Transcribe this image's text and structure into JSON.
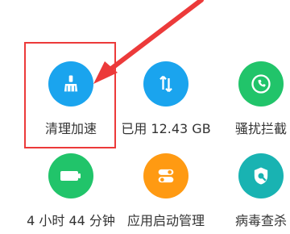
{
  "tiles": [
    {
      "label": "清理加速",
      "icon": "broom-icon",
      "color": "#1aa4ee"
    },
    {
      "label": "已用 12.43 GB",
      "icon": "swap-arrows-icon",
      "color": "#1aa4ee"
    },
    {
      "label": "骚扰拦截",
      "icon": "phone-block-icon",
      "color": "#21c46a"
    },
    {
      "label": "4 小时 44 分钟",
      "icon": "battery-icon",
      "color": "#21c46a"
    },
    {
      "label": "应用启动管理",
      "icon": "toggle-icon",
      "color": "#ff9a12"
    },
    {
      "label": "病毒查杀",
      "icon": "shield-search-icon",
      "color": "#19b3b2"
    }
  ],
  "highlight": {
    "target": "清理加速",
    "color": "#ec3a3a"
  }
}
